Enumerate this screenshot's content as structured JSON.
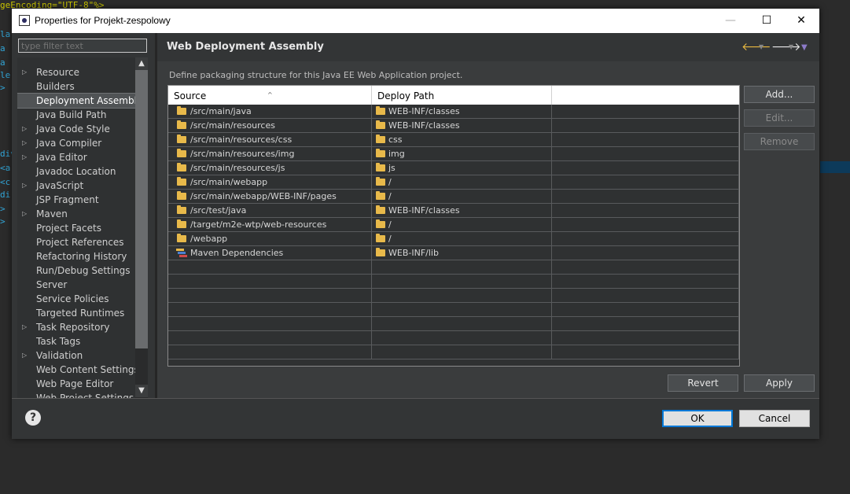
{
  "background_editor": {
    "lines": [
      {
        "text": "geEncoding=\"UTF-8\"%>",
        "color": "#c9c400"
      },
      {
        "text": "la",
        "color": "#32a6d8"
      },
      {
        "text": "a",
        "color": "#32a6d8"
      },
      {
        "text": "a",
        "color": "#32a6d8"
      },
      {
        "text": "le",
        "color": "#32a6d8"
      },
      {
        "text": ">",
        "color": "#32a6d8"
      },
      {
        "text": "",
        "color": "#32a6d8"
      },
      {
        "text": "",
        "color": "#32a6d8"
      },
      {
        "text": "",
        "color": "#32a6d8"
      },
      {
        "text": "div",
        "color": "#32a6d8"
      },
      {
        "text": "<a",
        "color": "#32a6d8"
      },
      {
        "text": "<c",
        "color": "#32a6d8"
      },
      {
        "text": "di",
        "color": "#32a6d8"
      },
      {
        "text": ">",
        "color": "#32a6d8"
      },
      {
        "text": ">",
        "color": "#32a6d8"
      }
    ]
  },
  "dialog": {
    "title": "Properties for Projekt-zespolowy",
    "controls": {
      "minimize": "—",
      "maximize": "☐",
      "close": "✕"
    }
  },
  "filter": {
    "placeholder": "type filter text"
  },
  "tree": {
    "items": [
      {
        "label": "Resource",
        "expandable": true,
        "selected": false
      },
      {
        "label": "Builders",
        "expandable": false,
        "selected": false
      },
      {
        "label": "Deployment Assembly",
        "expandable": false,
        "selected": true
      },
      {
        "label": "Java Build Path",
        "expandable": false,
        "selected": false
      },
      {
        "label": "Java Code Style",
        "expandable": true,
        "selected": false
      },
      {
        "label": "Java Compiler",
        "expandable": true,
        "selected": false
      },
      {
        "label": "Java Editor",
        "expandable": true,
        "selected": false
      },
      {
        "label": "Javadoc Location",
        "expandable": false,
        "selected": false
      },
      {
        "label": "JavaScript",
        "expandable": true,
        "selected": false
      },
      {
        "label": "JSP Fragment",
        "expandable": false,
        "selected": false
      },
      {
        "label": "Maven",
        "expandable": true,
        "selected": false
      },
      {
        "label": "Project Facets",
        "expandable": false,
        "selected": false
      },
      {
        "label": "Project References",
        "expandable": false,
        "selected": false
      },
      {
        "label": "Refactoring History",
        "expandable": false,
        "selected": false
      },
      {
        "label": "Run/Debug Settings",
        "expandable": false,
        "selected": false
      },
      {
        "label": "Server",
        "expandable": false,
        "selected": false
      },
      {
        "label": "Service Policies",
        "expandable": false,
        "selected": false
      },
      {
        "label": "Targeted Runtimes",
        "expandable": false,
        "selected": false
      },
      {
        "label": "Task Repository",
        "expandable": true,
        "selected": false
      },
      {
        "label": "Task Tags",
        "expandable": false,
        "selected": false
      },
      {
        "label": "Validation",
        "expandable": true,
        "selected": false
      },
      {
        "label": "Web Content Settings",
        "expandable": false,
        "selected": false
      },
      {
        "label": "Web Page Editor",
        "expandable": false,
        "selected": false
      },
      {
        "label": "Web Project Settings",
        "expandable": false,
        "selected": false
      }
    ]
  },
  "page": {
    "title": "Web Deployment Assembly",
    "description": "Define packaging structure for this Java EE Web Application project."
  },
  "table": {
    "columns": [
      "Source",
      "Deploy Path",
      ""
    ],
    "rows": [
      {
        "source": "/src/main/java",
        "deploy": "WEB-INF/classes",
        "icon": "folder"
      },
      {
        "source": "/src/main/resources",
        "deploy": "WEB-INF/classes",
        "icon": "folder"
      },
      {
        "source": "/src/main/resources/css",
        "deploy": "css",
        "icon": "folder"
      },
      {
        "source": "/src/main/resources/img",
        "deploy": "img",
        "icon": "folder"
      },
      {
        "source": "/src/main/resources/js",
        "deploy": "js",
        "icon": "folder"
      },
      {
        "source": "/src/main/webapp",
        "deploy": "/",
        "icon": "folder"
      },
      {
        "source": "/src/main/webapp/WEB-INF/pages",
        "deploy": "/",
        "icon": "folder"
      },
      {
        "source": "/src/test/java",
        "deploy": "WEB-INF/classes",
        "icon": "folder"
      },
      {
        "source": "/target/m2e-wtp/web-resources",
        "deploy": "/",
        "icon": "folder"
      },
      {
        "source": "/webapp",
        "deploy": "/",
        "icon": "folder"
      },
      {
        "source": "Maven Dependencies",
        "deploy": "WEB-INF/lib",
        "icon": "library"
      }
    ],
    "empty_rows": 7
  },
  "buttons": {
    "add": "Add...",
    "edit": "Edit...",
    "remove": "Remove",
    "revert": "Revert",
    "apply": "Apply",
    "ok": "OK",
    "cancel": "Cancel"
  },
  "icons": {
    "help": "?",
    "nav_back": "🡐",
    "nav_forward": "🡒",
    "dropdown": "▼"
  },
  "colors": {
    "accent": "#0078d7",
    "folder": "#e8b94a",
    "dialog_bg": "#333536"
  }
}
